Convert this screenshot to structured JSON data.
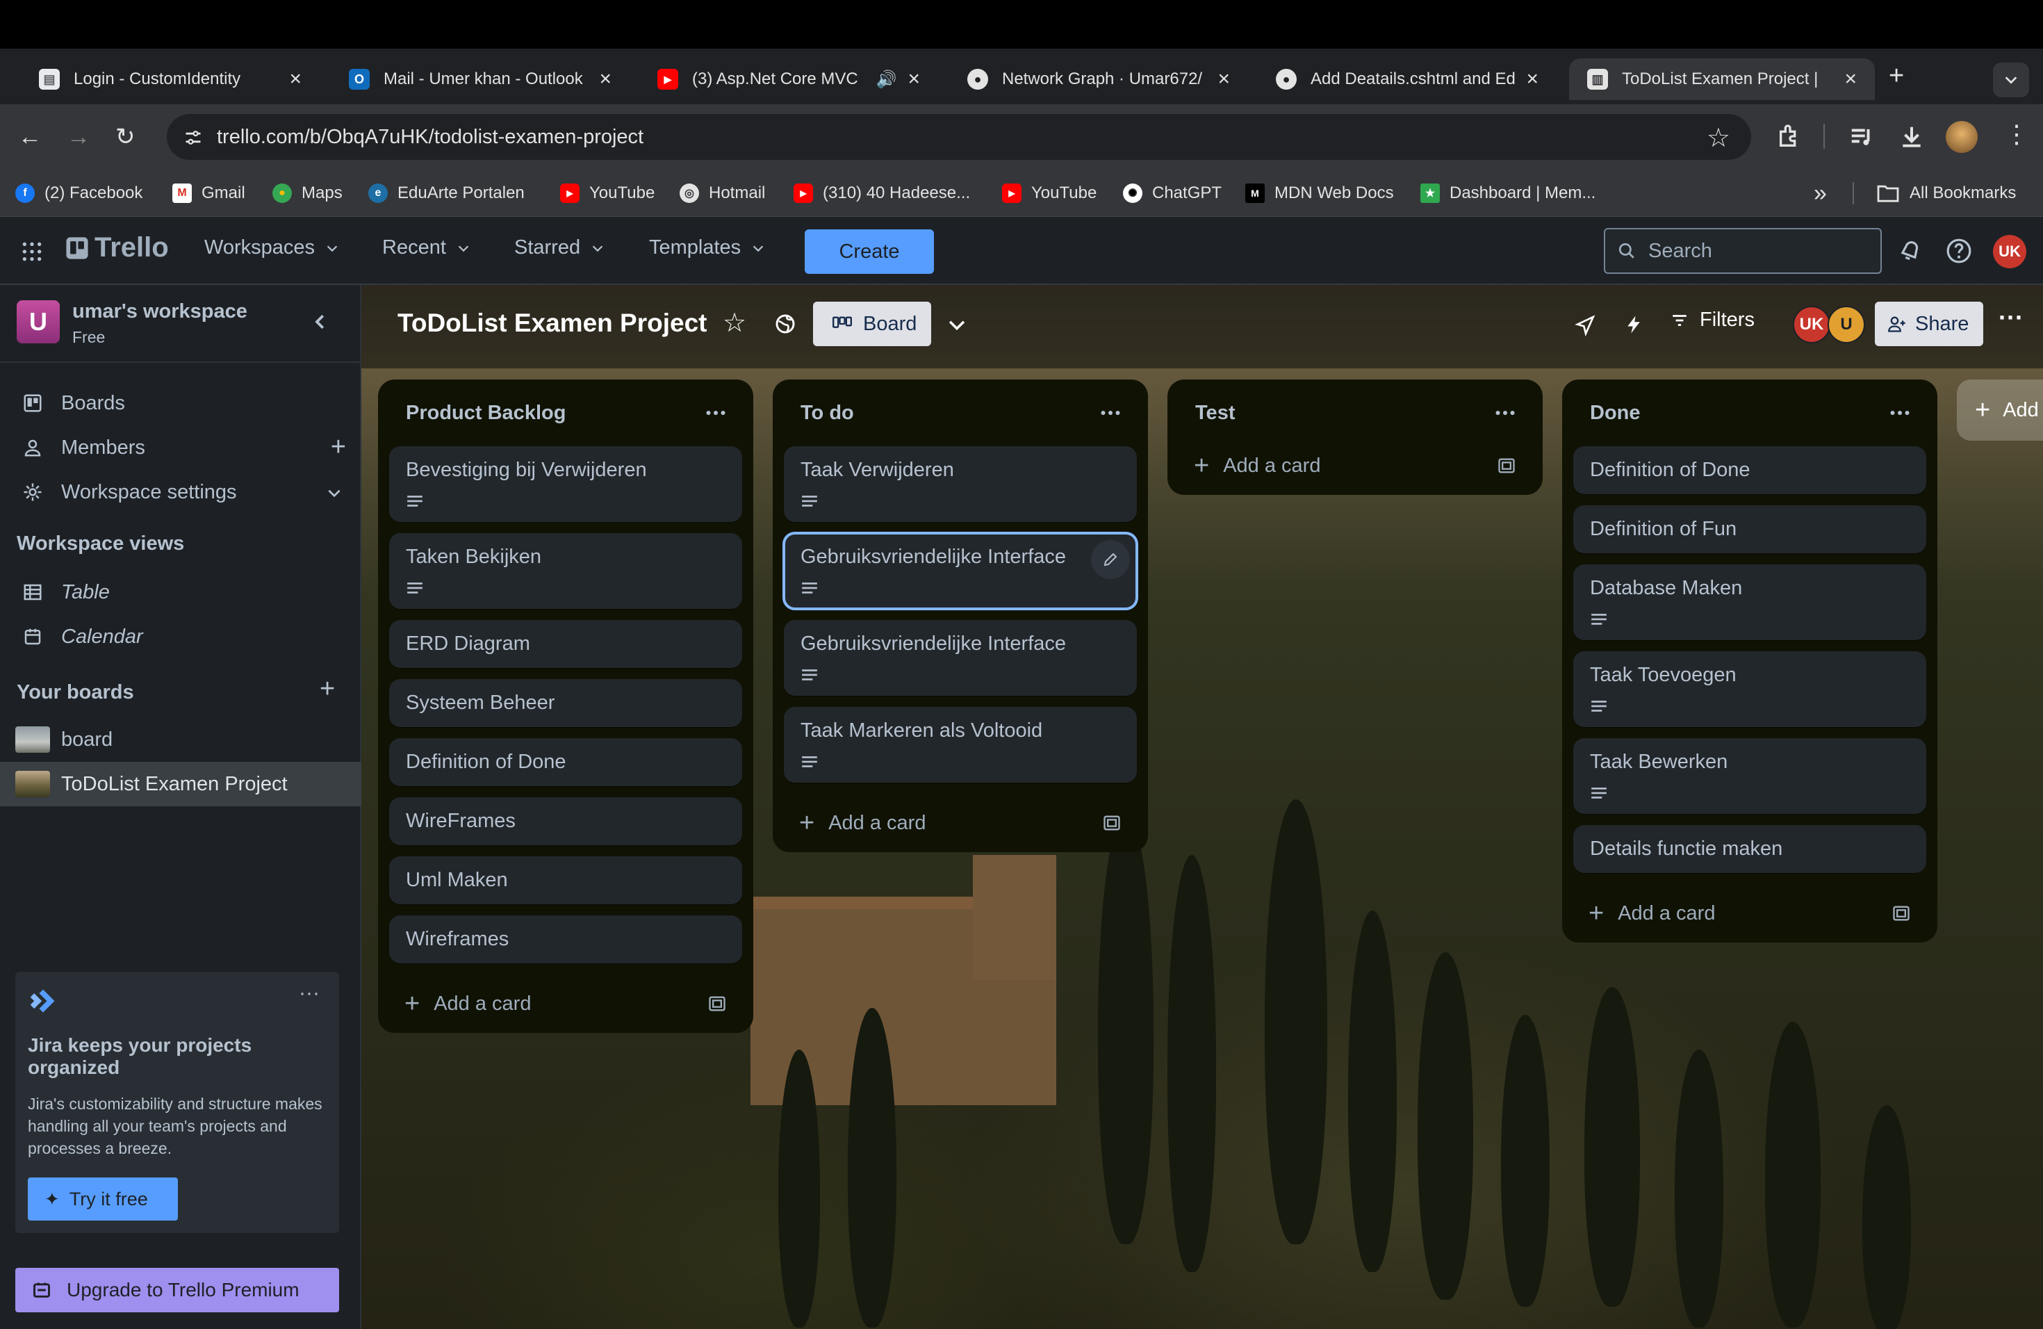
{
  "browser": {
    "tabs": [
      {
        "title": "Login - CustomIdentity",
        "icon": "page-icon"
      },
      {
        "title": "Mail - Umer khan - Outlook",
        "icon": "outlook-icon"
      },
      {
        "title": "(3) Asp.Net Core MVC",
        "icon": "youtube-icon"
      },
      {
        "title": "Network Graph · Umar672/",
        "icon": "github-icon"
      },
      {
        "title": "Add Deatails.cshtml and Ed",
        "icon": "github-icon"
      },
      {
        "title": "ToDoList Examen Project |",
        "icon": "trello-icon"
      }
    ],
    "new_tab": "+",
    "url": "trello.com/b/ObqA7uHK/todolist-examen-project",
    "bookmarks": [
      {
        "label": "(2) Facebook",
        "icon": "facebook-icon"
      },
      {
        "label": "Gmail",
        "icon": "gmail-icon"
      },
      {
        "label": "Maps",
        "icon": "maps-icon"
      },
      {
        "label": "EduArte Portalen",
        "icon": "eduarte-icon"
      },
      {
        "label": "YouTube",
        "icon": "youtube-icon"
      },
      {
        "label": "Hotmail",
        "icon": "hotmail-icon"
      },
      {
        "label": "(310) 40 Hadeese...",
        "icon": "youtube-icon"
      },
      {
        "label": "YouTube",
        "icon": "youtube-icon"
      },
      {
        "label": "ChatGPT",
        "icon": "chatgpt-icon"
      },
      {
        "label": "MDN Web Docs",
        "icon": "mdn-icon"
      },
      {
        "label": "Dashboard | Mem...",
        "icon": "dashboard-icon"
      }
    ],
    "more_bookmarks": "»",
    "all_bookmarks": "All Bookmarks"
  },
  "trello": {
    "logo": "Trello",
    "nav": [
      "Workspaces",
      "Recent",
      "Starred",
      "Templates"
    ],
    "create": "Create",
    "search_placeholder": "Search",
    "user_initials": "UK"
  },
  "sidebar": {
    "workspace_initial": "U",
    "workspace_name": "umar's workspace",
    "workspace_plan": "Free",
    "items": [
      {
        "label": "Boards",
        "icon": "boards-icon"
      },
      {
        "label": "Members",
        "icon": "members-icon"
      },
      {
        "label": "Workspace settings",
        "icon": "gear-icon"
      }
    ],
    "views_heading": "Workspace views",
    "views": [
      {
        "label": "Table",
        "icon": "table-icon"
      },
      {
        "label": "Calendar",
        "icon": "calendar-icon"
      }
    ],
    "boards_heading": "Your boards",
    "boards": [
      {
        "label": "board"
      },
      {
        "label": "ToDoList Examen Project"
      }
    ],
    "promo": {
      "title": "Jira keeps your projects organized",
      "body": "Jira's customizability and structure makes handling all your team's projects and processes a breeze.",
      "cta": "Try it free"
    },
    "upgrade": "Upgrade to Trello Premium"
  },
  "board": {
    "title": "ToDoList Examen Project",
    "view": "Board",
    "filters": "Filters",
    "share": "Share",
    "members": [
      "UK",
      "U"
    ],
    "add_list": "Add",
    "add_card": "Add a card",
    "lists": [
      {
        "name": "Product Backlog",
        "cards": [
          {
            "title": "Bevestiging bij Verwijderen",
            "desc": true
          },
          {
            "title": "Taken Bekijken",
            "desc": true
          },
          {
            "title": "ERD Diagram",
            "desc": false
          },
          {
            "title": "Systeem Beheer",
            "desc": false
          },
          {
            "title": "Definition of Done",
            "desc": false
          },
          {
            "title": "WireFrames",
            "desc": false
          },
          {
            "title": "Uml Maken",
            "desc": false
          },
          {
            "title": "Wireframes",
            "desc": false
          }
        ]
      },
      {
        "name": "To do",
        "cards": [
          {
            "title": "Taak Verwijderen",
            "desc": true
          },
          {
            "title": "Gebruiksvriendelijke Interface",
            "desc": true,
            "selected": true
          },
          {
            "title": "Gebruiksvriendelijke Interface",
            "desc": true
          },
          {
            "title": "Taak Markeren als Voltooid",
            "desc": true
          }
        ]
      },
      {
        "name": "Test",
        "cards": []
      },
      {
        "name": "Done",
        "cards": [
          {
            "title": "Definition of Done",
            "desc": false
          },
          {
            "title": "Definition of Fun",
            "desc": false
          },
          {
            "title": "Database Maken",
            "desc": true
          },
          {
            "title": "Taak Toevoegen",
            "desc": true
          },
          {
            "title": "Taak Bewerken",
            "desc": true
          },
          {
            "title": "Details functie maken",
            "desc": false
          }
        ]
      }
    ]
  },
  "colors": {
    "accent": "#579dff",
    "selected_border": "#85b8ff",
    "avatar_uk": "#c9372c",
    "avatar_u": "#e2a031",
    "workspace_badge": "#ae2e8b",
    "upgrade_bg": "#9f8fef"
  }
}
